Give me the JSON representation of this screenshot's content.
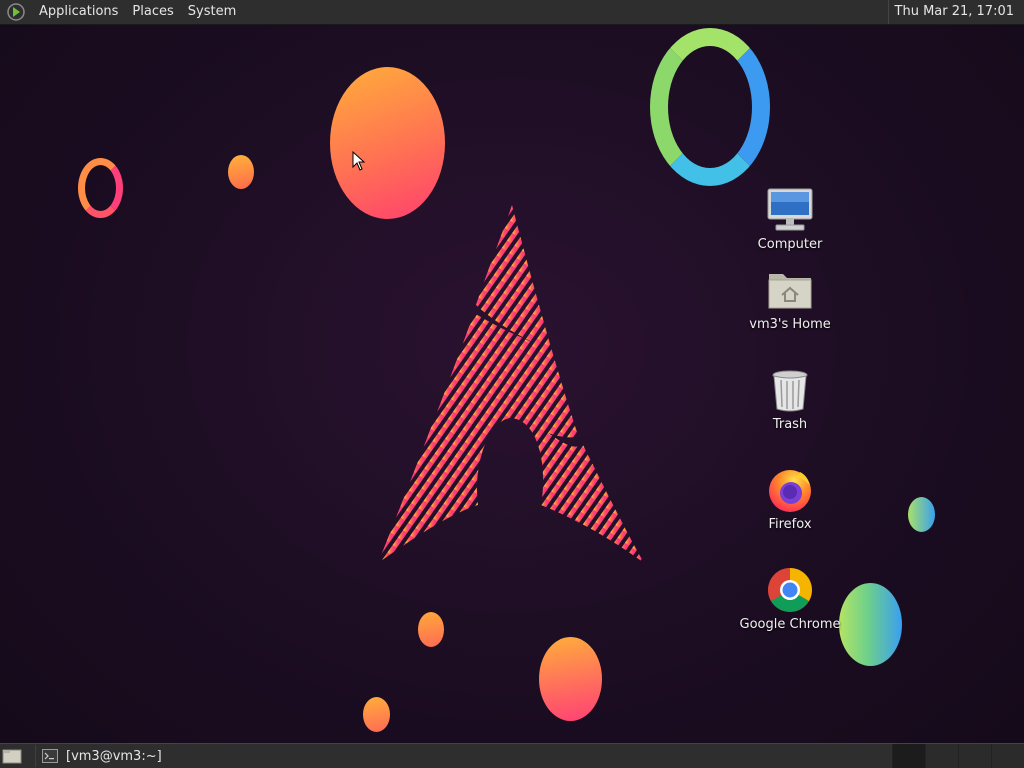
{
  "top_panel": {
    "menus": [
      "Applications",
      "Places",
      "System"
    ],
    "clock": "Thu Mar 21, 17:01"
  },
  "desktop": {
    "icons": [
      {
        "label": "Computer",
        "icon": "computer-icon"
      },
      {
        "label": "vm3's Home",
        "icon": "home-folder-icon"
      },
      {
        "label": "Trash",
        "icon": "trash-icon"
      },
      {
        "label": "Firefox",
        "icon": "firefox-icon"
      },
      {
        "label": "Google Chrome",
        "icon": "chrome-icon"
      }
    ]
  },
  "bottom_panel": {
    "taskbar_items": [
      {
        "label": "[vm3@vm3:~]",
        "icon": "terminal-icon"
      }
    ],
    "workspace_count": 4,
    "active_workspace": 1
  },
  "colors": {
    "panel_bg": "#2e2e2e",
    "desktop_bg": "#1c0d22",
    "arch_pink": "#ff3f7a",
    "arch_yellow": "#ffd23a"
  }
}
